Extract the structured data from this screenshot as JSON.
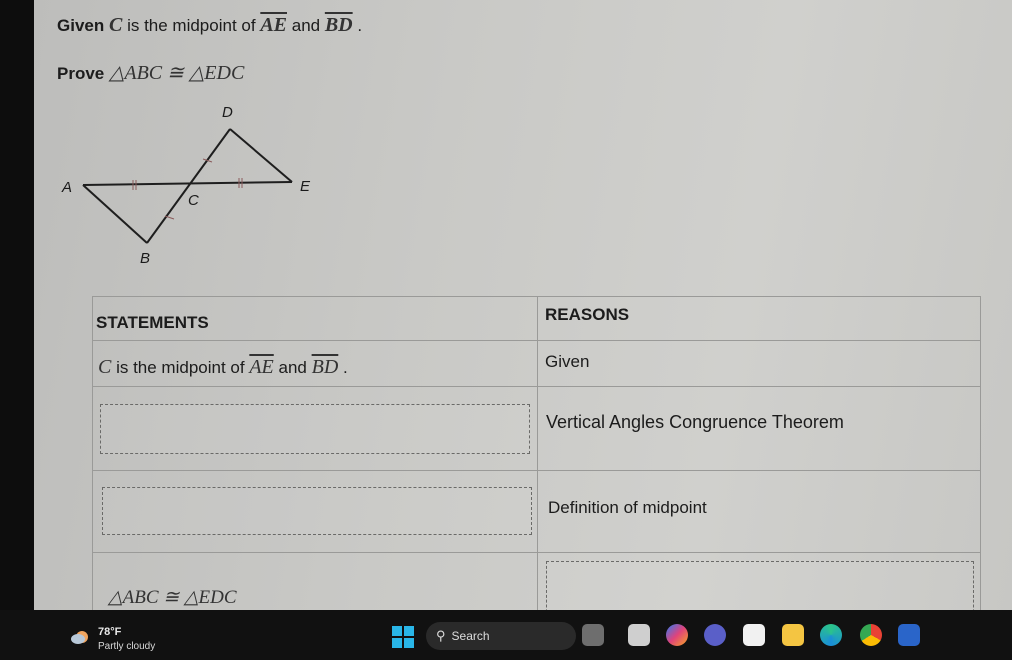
{
  "problem": {
    "given_prefix": "Given",
    "given_point": "C",
    "given_middle": "is the midpoint of",
    "given_seg1": "AE",
    "given_and": "and",
    "given_seg2": "BD",
    "given_end": ".",
    "prove_prefix": "Prove",
    "prove_statement": "△ABC ≅ △EDC"
  },
  "diagram": {
    "labels": {
      "A": "A",
      "B": "B",
      "C": "C",
      "D": "D",
      "E": "E"
    }
  },
  "table": {
    "headers": {
      "statements": "STATEMENTS",
      "reasons": "REASONS"
    },
    "rows": [
      {
        "statement": {
          "point": "C",
          "text": "is the midpoint of",
          "seg1": "AE",
          "and": "and",
          "seg2": "BD",
          "end": "."
        },
        "reason": "Given"
      },
      {
        "statement_blank": true,
        "reason": "Vertical Angles Congruence Theorem"
      },
      {
        "statement_blank": true,
        "reason": "Definition of midpoint"
      },
      {
        "statement": "△ABC ≅ △EDC",
        "reason_blank": true
      }
    ]
  },
  "taskbar": {
    "weather_temp": "78°F",
    "weather_condition": "Partly cloudy",
    "search_label": "Search",
    "apps": [
      "widgets-icon",
      "file-icon",
      "copilot-icon",
      "teams-icon",
      "store-icon",
      "file-explorer-icon",
      "edge-icon",
      "chrome-icon",
      "word-icon"
    ]
  }
}
